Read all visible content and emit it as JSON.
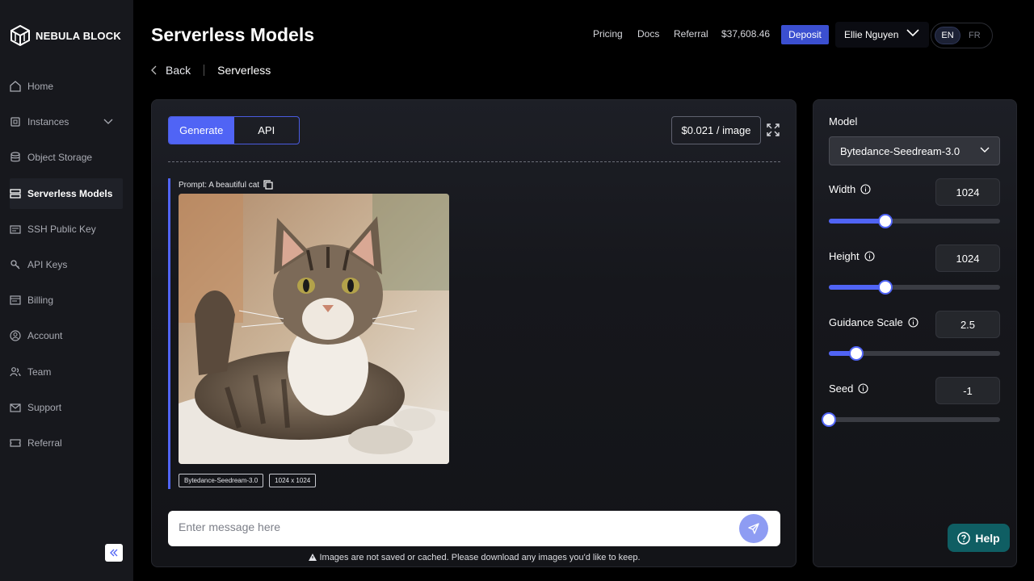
{
  "brand": {
    "name": "NEBULA BLOCK"
  },
  "sidebar": {
    "items": [
      {
        "label": "Home",
        "icon": "home-icon"
      },
      {
        "label": "Instances",
        "icon": "cpu-icon"
      },
      {
        "label": "Object Storage",
        "icon": "database-icon"
      },
      {
        "label": "Serverless Models",
        "icon": "server-icon",
        "active": true
      },
      {
        "label": "SSH Public Key",
        "icon": "key-card-icon"
      },
      {
        "label": "API Keys",
        "icon": "key-icon"
      },
      {
        "label": "Billing",
        "icon": "billing-icon"
      },
      {
        "label": "Account",
        "icon": "account-icon"
      },
      {
        "label": "Team",
        "icon": "team-icon"
      },
      {
        "label": "Support",
        "icon": "mail-icon"
      },
      {
        "label": "Referral",
        "icon": "ticket-icon"
      }
    ]
  },
  "header": {
    "title": "Serverless Models",
    "links": {
      "pricing": "Pricing",
      "docs": "Docs",
      "referral": "Referral"
    },
    "balance": "$37,608.46",
    "deposit": "Deposit",
    "user": "Ellie Nguyen",
    "lang": {
      "en": "EN",
      "fr": "FR"
    }
  },
  "breadcrumb": {
    "back": "Back",
    "current": "Serverless"
  },
  "main": {
    "tabs": {
      "generate": "Generate",
      "api": "API"
    },
    "price": "$0.021 / image",
    "prompt": "Prompt: A beautiful cat",
    "tags": {
      "model": "Bytedance-Seedream-3.0",
      "size": "1024 x 1024"
    },
    "input_placeholder": "Enter message here",
    "note": "Images are not saved or cached. Please download any images you'd like to keep."
  },
  "settings": {
    "model_label": "Model",
    "model_value": "Bytedance-Seedream-3.0",
    "width": {
      "label": "Width",
      "value": "1024",
      "fraction": 0.33
    },
    "height": {
      "label": "Height",
      "value": "1024",
      "fraction": 0.33
    },
    "guidance": {
      "label": "Guidance Scale",
      "value": "2.5",
      "fraction": 0.16
    },
    "seed": {
      "label": "Seed",
      "value": "-1",
      "fraction": 0.0
    }
  },
  "help": "Help",
  "colors": {
    "accent": "#5064f5",
    "deposit": "#3b4fd0",
    "help": "#0f5e63"
  }
}
